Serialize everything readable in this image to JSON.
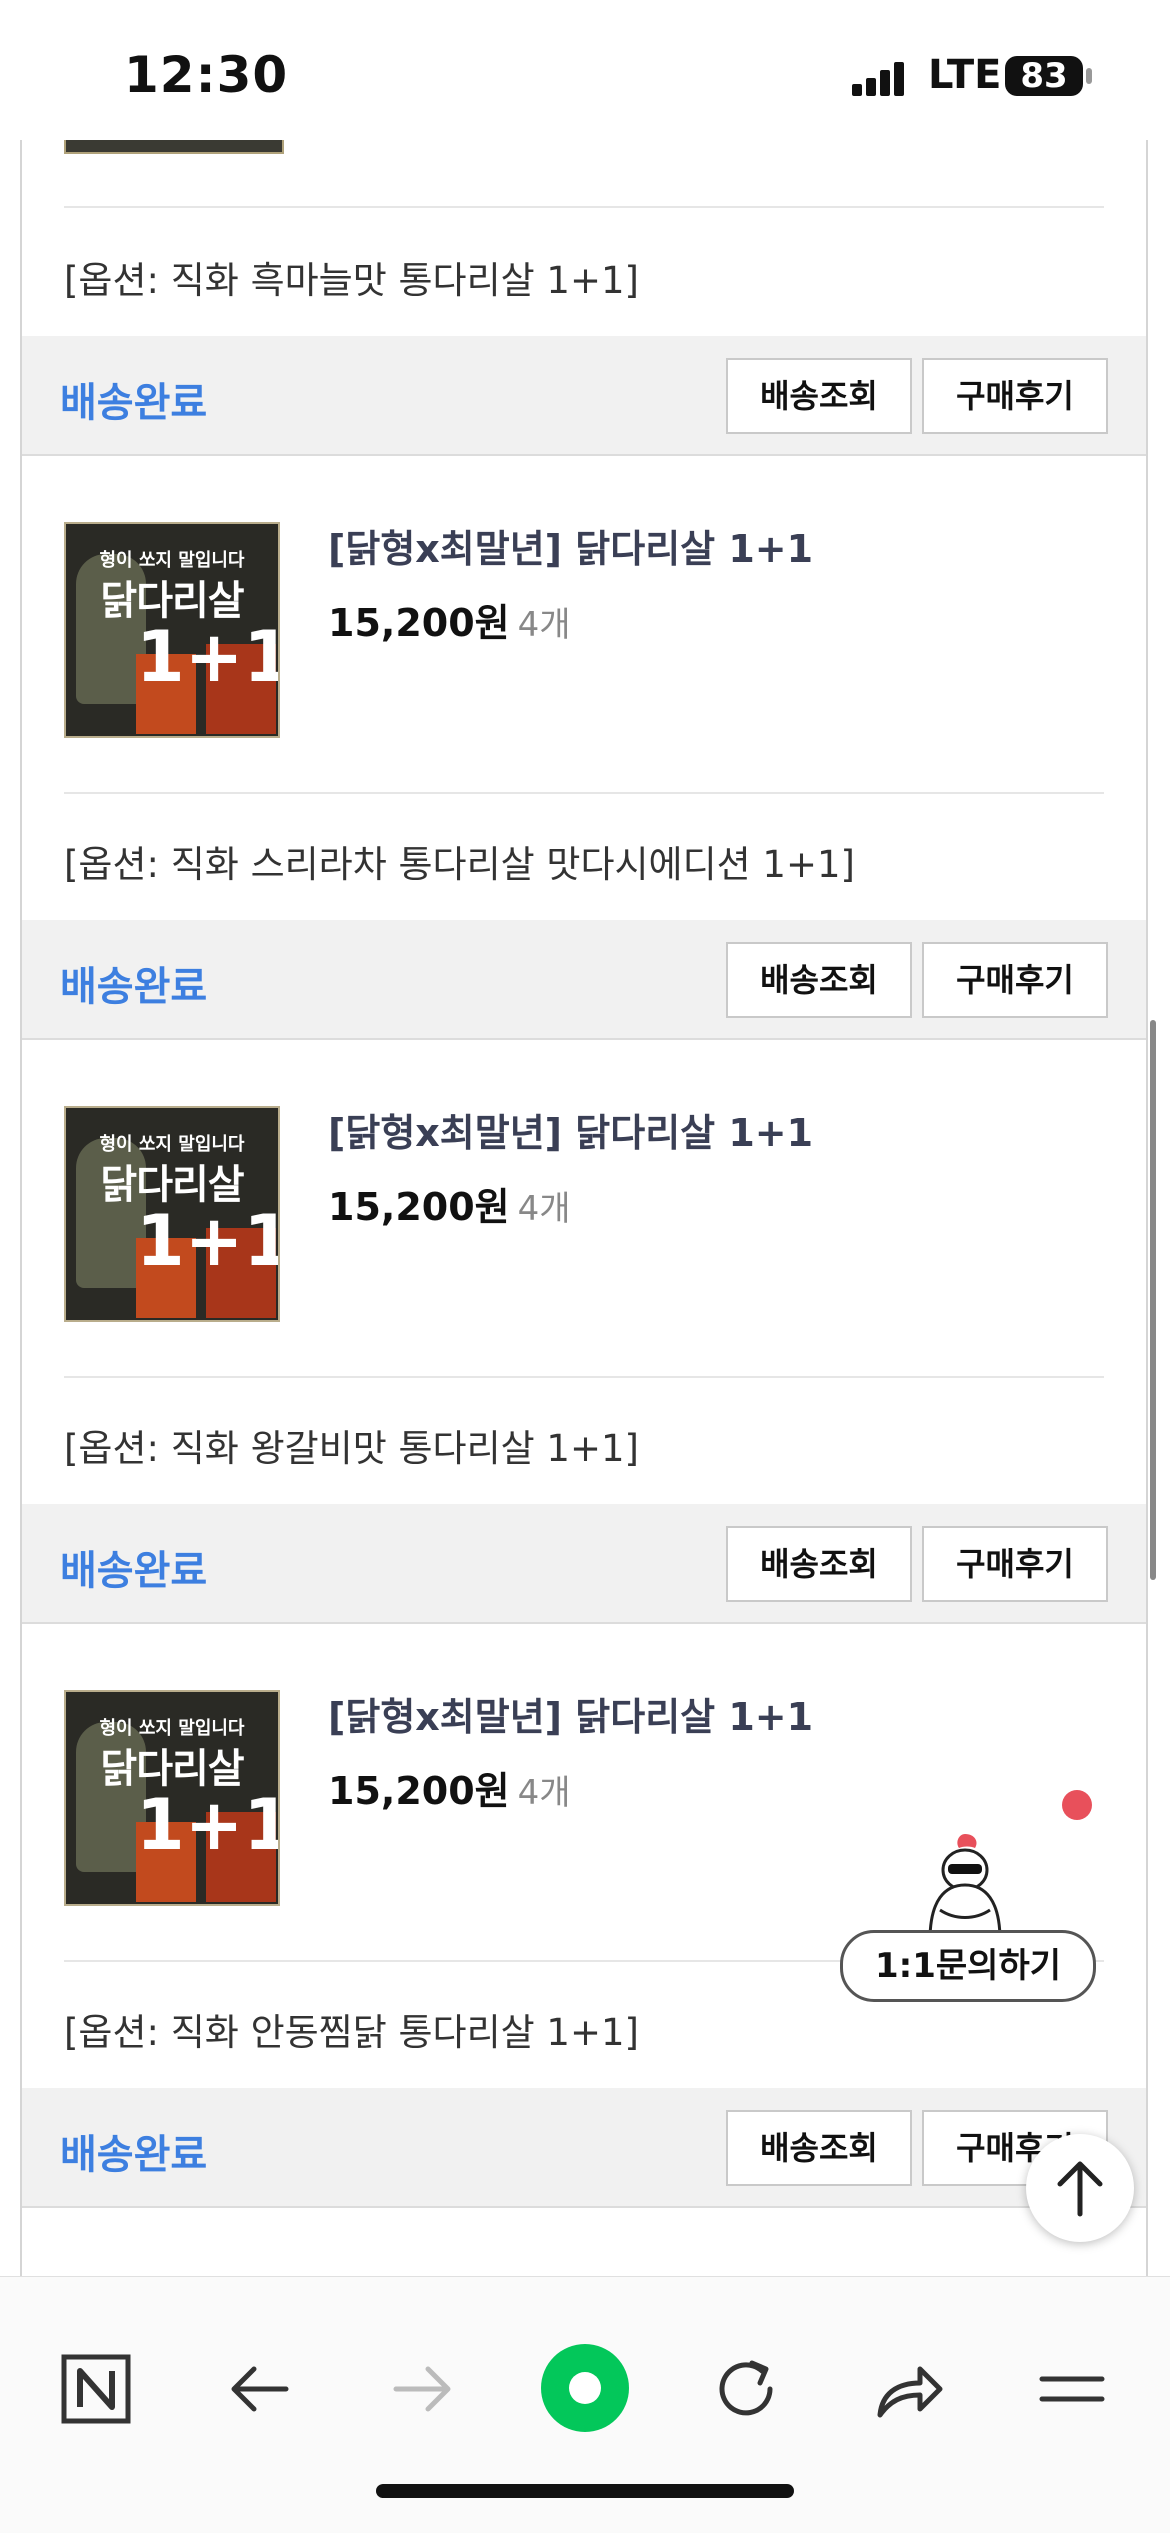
{
  "status_bar": {
    "time": "12:30",
    "network": "LTE",
    "battery": "83"
  },
  "option_prefix": "[옵션: ",
  "top_option": "[옵션: 직화 흑마늘맛 통다리살 1+1]",
  "orders": [
    {
      "status": "배송완료",
      "track_label": "배송조회",
      "review_label": "구매후기"
    },
    {
      "product": {
        "image_text_top": "형이 쏘지 말입니다",
        "image_text_main": "닭다리살",
        "image_text_big": "1+1",
        "title": "[닭형x최말년] 닭다리살 1+1",
        "price": "15,200원",
        "quantity": "4개"
      },
      "option": "[옵션: 직화 스리라차 통다리살 맛다시에디션 1+1]",
      "status": "배송완료",
      "track_label": "배송조회",
      "review_label": "구매후기"
    },
    {
      "product": {
        "image_text_top": "형이 쏘지 말입니다",
        "image_text_main": "닭다리살",
        "image_text_big": "1+1",
        "title": "[닭형x최말년] 닭다리살 1+1",
        "price": "15,200원",
        "quantity": "4개"
      },
      "option": "[옵션: 직화 왕갈비맛 통다리살 1+1]",
      "status": "배송완료",
      "track_label": "배송조회",
      "review_label": "구매후기"
    },
    {
      "product": {
        "image_text_top": "형이 쏘지 말입니다",
        "image_text_main": "닭다리살",
        "image_text_big": "1+1",
        "title": "[닭형x최말년] 닭다리살 1+1",
        "price": "15,200원",
        "quantity": "4개"
      },
      "option": "[옵션: 직화 안동찜닭 통다리살 1+1]",
      "status": "배송완료",
      "track_label": "배송조회",
      "review_label": "구매후기"
    }
  ],
  "floating": {
    "inquiry_label": "1:1문의하기"
  },
  "colors": {
    "status_blue": "#3d7fe0",
    "naver_green": "#03c75a",
    "notif_red": "#e8505b"
  },
  "toolbar_icons": [
    "naver-home-icon",
    "back-arrow-icon",
    "forward-arrow-icon",
    "green-dot-icon",
    "refresh-icon",
    "share-icon",
    "menu-icon"
  ]
}
